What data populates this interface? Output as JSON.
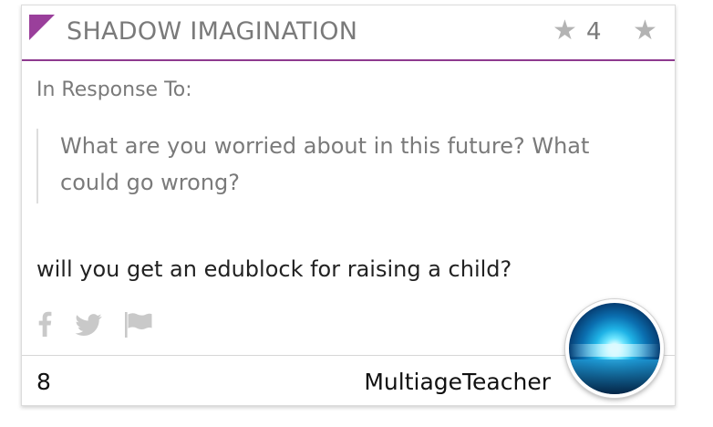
{
  "header": {
    "category": "SHADOW IMAGINATION",
    "star_count": "4",
    "colors": {
      "accent": "#9a3f9b",
      "divider": "#8e3a8f",
      "star": "#b3b3b3"
    }
  },
  "response": {
    "label": "In Response To:",
    "quote_line1": "What are you worried about in this future? What",
    "quote_line2": "could go wrong?"
  },
  "body": {
    "text": "will you get an edublock for raising a child?"
  },
  "share": {
    "icons": [
      "facebook-icon",
      "twitter-icon",
      "flag-icon"
    ]
  },
  "footer": {
    "count": "8",
    "author": "MultiageTeacher"
  }
}
